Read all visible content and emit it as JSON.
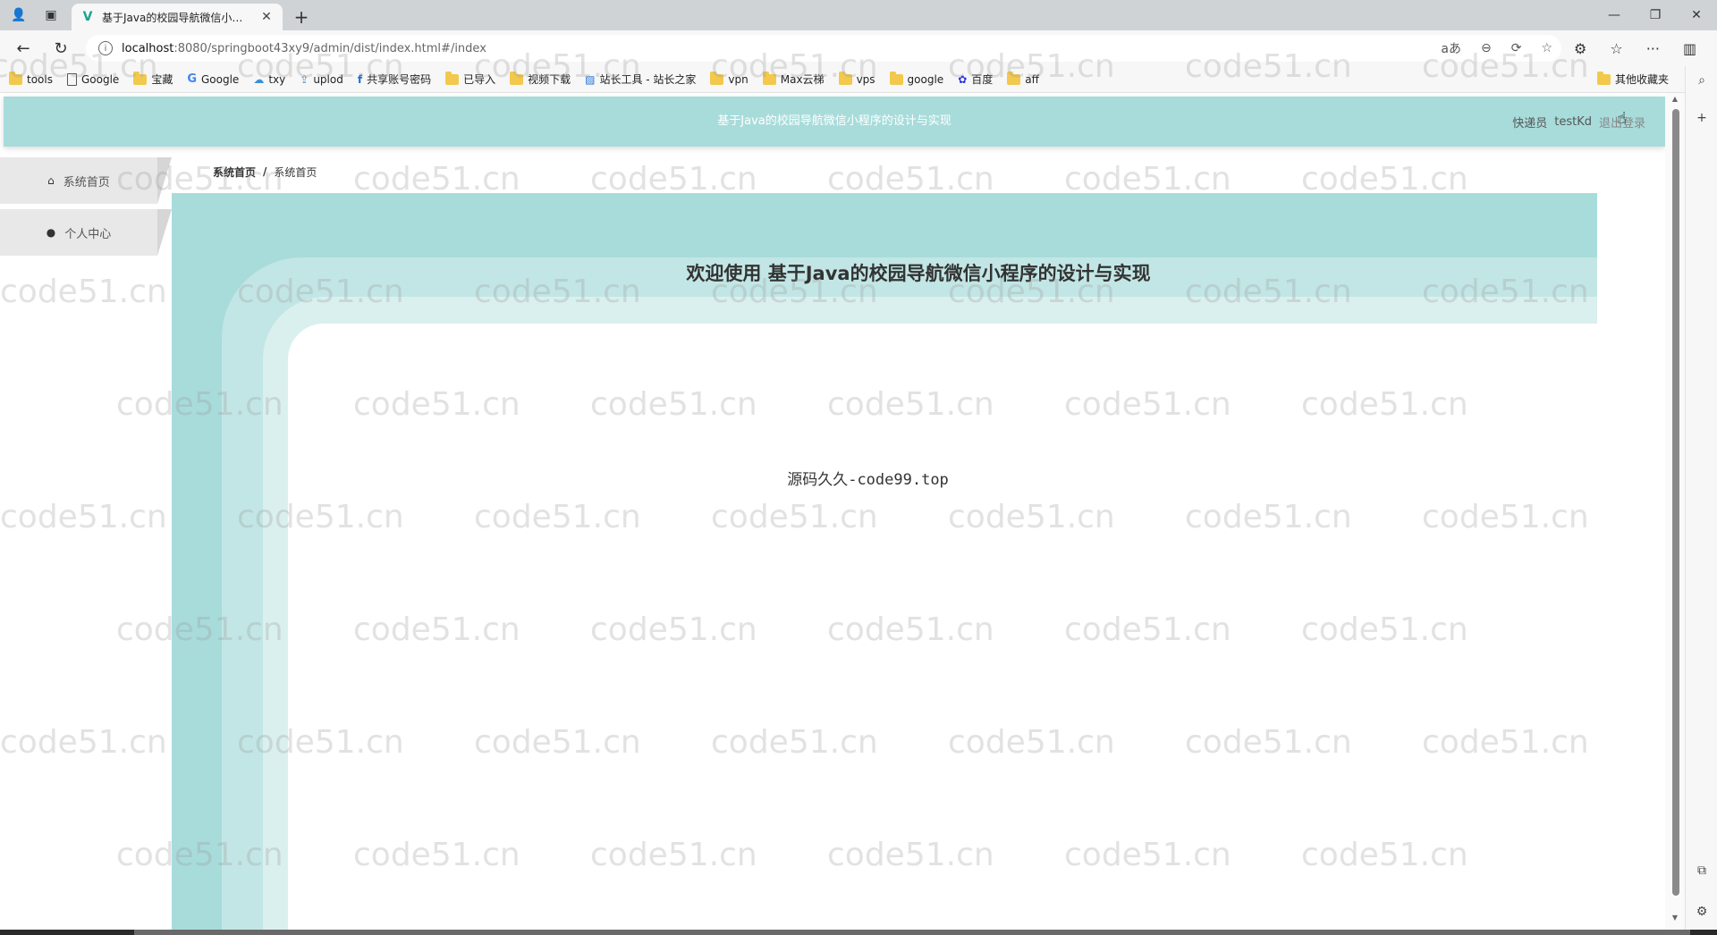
{
  "browser": {
    "tab_title": "基于Java的校园导航微信小程序的",
    "url_host": "localhost",
    "url_path": ":8080/springboot43xy9/admin/dist/index.html#/index",
    "bookmarks": [
      {
        "label": "tools",
        "icon": "folder-icon"
      },
      {
        "label": "Google",
        "icon": "page-icon"
      },
      {
        "label": "宝藏",
        "icon": "folder-icon"
      },
      {
        "label": "Google",
        "icon": "google-icon"
      },
      {
        "label": "txy",
        "icon": "cloud-icon"
      },
      {
        "label": "uplod",
        "icon": "upload-icon"
      },
      {
        "label": "共享账号密码",
        "icon": "share-icon"
      },
      {
        "label": "已导入",
        "icon": "folder-icon"
      },
      {
        "label": "视频下载",
        "icon": "folder-icon"
      },
      {
        "label": "站长工具 - 站长之家",
        "icon": "site-icon"
      },
      {
        "label": "vpn",
        "icon": "folder-icon"
      },
      {
        "label": "Max云梯",
        "icon": "folder-icon"
      },
      {
        "label": "vps",
        "icon": "folder-icon"
      },
      {
        "label": "google",
        "icon": "folder-icon"
      },
      {
        "label": "百度",
        "icon": "baidu-icon"
      },
      {
        "label": "aff",
        "icon": "folder-icon"
      }
    ],
    "other_bookmarks": "其他收藏夹"
  },
  "header": {
    "title": "基于Java的校园导航微信小程序的设计与实现",
    "role": "快递员",
    "username": "testKd",
    "logout": "退出登录"
  },
  "sidebar": {
    "items": [
      {
        "label": "系统首页",
        "icon": "home-icon"
      },
      {
        "label": "个人中心",
        "icon": "user-icon"
      }
    ]
  },
  "breadcrumb": {
    "first": "系统首页",
    "separator": "/",
    "current": "系统首页"
  },
  "main": {
    "welcome": "欢迎使用 基于Java的校园导航微信小程序的设计与实现",
    "center_text": "源码久久-code99.top"
  },
  "watermark": "code51.cn",
  "colors": {
    "header_bg": "#a8dcdb",
    "band2": "#c2e6e5",
    "band3": "#daf0ef"
  }
}
